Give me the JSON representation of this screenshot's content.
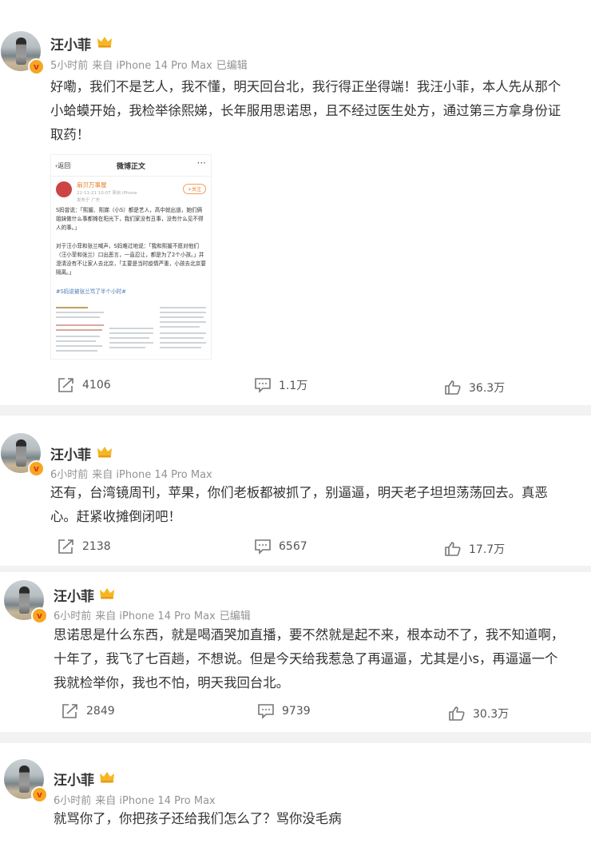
{
  "posts": [
    {
      "author": "汪小菲",
      "time": "5小时前",
      "source": "来自 iPhone 14 Pro Max",
      "edited": "已编辑",
      "text": "好嘞，我们不是艺人，我不懂，明天回台北，我行得正坐得端！我汪小菲，本人先从那个小蛤蟆开始，我检举徐熙娣，长年服用思诺思，且不经过医生处方，通过第三方拿身份证取药！",
      "forwards": "4106",
      "comments": "1.1万",
      "likes": "36.3万",
      "image": {
        "back": "返回",
        "title": "微博正文",
        "author": "扇贝万事屋",
        "time": "22-11-21 10:07 来自 iPhone",
        "follow": "+关注",
        "sub": "发布于 广东",
        "p1": "S妈曾说：「熙媛、熙娣（小S）都是艺人，高中就出道，她们俩姐妹做什么事都摊在阳光下，我们家没有丑事，没有什么见不得人的事。」",
        "p2": "对于汪小菲和张兰喊声，S妈难过地说：「我和熙媛不愿对他们（汪小菲和张兰）口出恶言，一直忍让，都是为了2个小孩。」并澄清没有不让家人去北京，「主要是当时疫情严重，小孩去北京要隔离。」",
        "hashtag": "#S妈说被张兰骂了半个小时#"
      }
    },
    {
      "author": "汪小菲",
      "time": "6小时前",
      "source": "来自 iPhone 14 Pro Max",
      "edited": "",
      "text": "还有，台湾镜周刊，苹果，你们老板都被抓了，别逼逼，明天老子坦坦荡荡回去。真恶心。赶紧收摊倒闭吧！",
      "forwards": "2138",
      "comments": "6567",
      "likes": "17.7万"
    },
    {
      "author": "汪小菲",
      "time": "6小时前",
      "source": "来自 iPhone 14 Pro Max",
      "edited": "已编辑",
      "text": "思诺思是什么东西，就是喝酒哭加直播，要不然就是起不来，根本动不了，我不知道啊，十年了，我飞了七百趟，不想说。但是今天给我惹急了再逼逼，尤其是小s，再逼逼一个我就检举你，我也不怕，明天我回台北。",
      "forwards": "2849",
      "comments": "9739",
      "likes": "30.3万"
    },
    {
      "author": "汪小菲",
      "time": "6小时前",
      "source": "来自 iPhone 14 Pro Max",
      "edited": "",
      "text": "就骂你了，你把孩子还给我们怎么了？骂你没毛病"
    }
  ],
  "colors": {
    "meta": "#939393",
    "badge": "#f5a623",
    "link": "#4a7ab5",
    "page_bg": "#f2f2f2"
  },
  "icons": [
    "verified-v-icon",
    "crown-icon",
    "forward-icon",
    "comment-icon",
    "like-icon"
  ]
}
